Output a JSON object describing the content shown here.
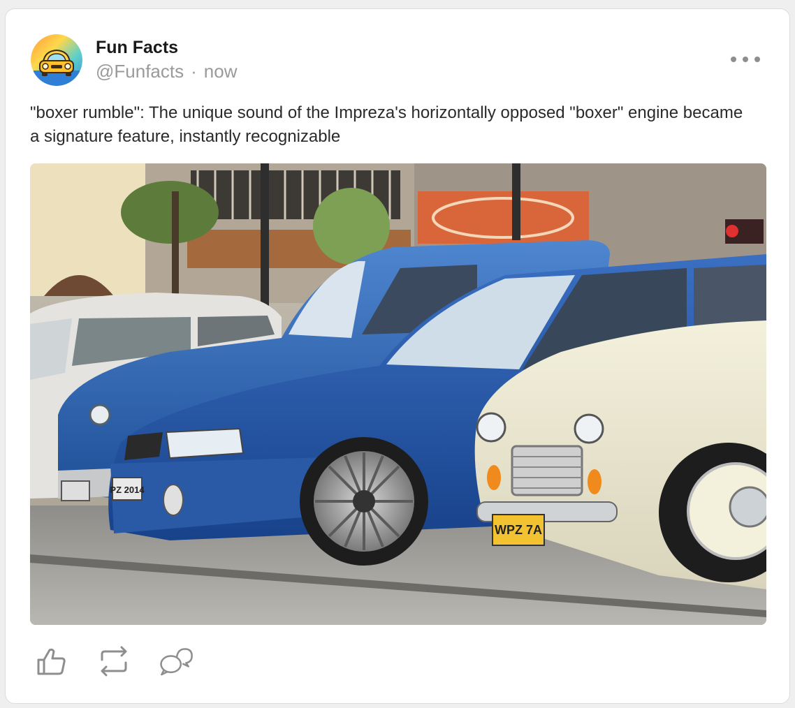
{
  "post": {
    "author": {
      "name": "Fun Facts",
      "handle": "@Funfacts",
      "separator": "·",
      "time": "now",
      "avatar_icon": "car-avatar-icon"
    },
    "text": "\"boxer rumble\": The unique sound of the Impreza's horizontally opposed \"boxer\" engine became a signature feature, instantly recognizable",
    "image": {
      "plates": [
        "PZ 2014",
        "WPZ 7A"
      ]
    },
    "actions": [
      {
        "icon": "like-icon"
      },
      {
        "icon": "repost-icon"
      },
      {
        "icon": "comment-icon"
      }
    ]
  },
  "colors": {
    "accent_blue": "#2f5fb0",
    "text_primary": "#1a1a1a",
    "text_muted": "#9a9a9a",
    "icon_gray": "#8e8e8e"
  }
}
